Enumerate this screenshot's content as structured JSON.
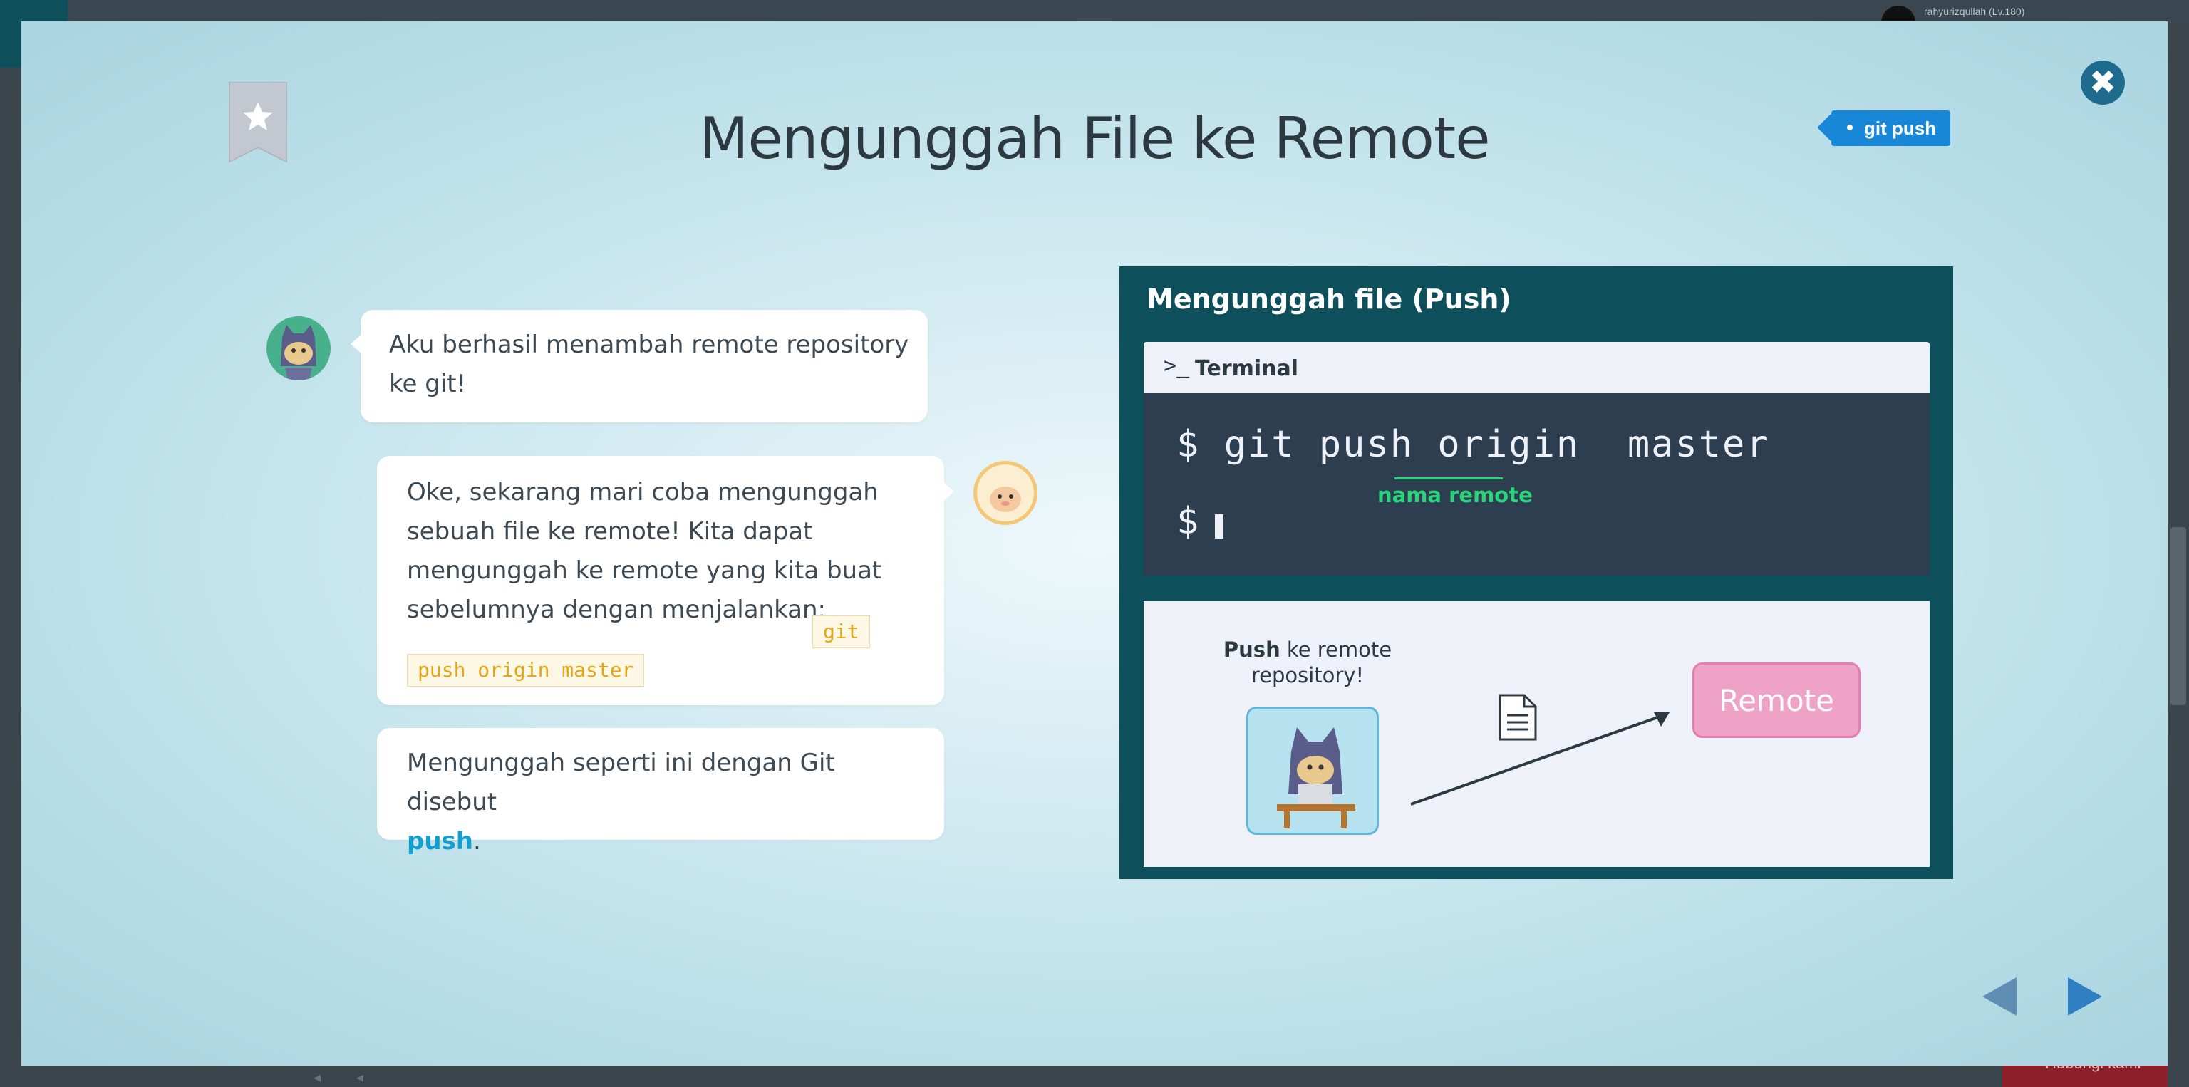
{
  "background": {
    "user_name": "rahyurizqullah (Lv.180)",
    "button_label": "Hubungi kami"
  },
  "modal": {
    "title": "Mengunggah File ke Remote",
    "tag": "git push",
    "close_icon": "close-icon",
    "bookmark_icon": "star-bookmark-icon"
  },
  "chat": {
    "msg1": "Aku berhasil menambah remote repository ke git!",
    "msg2_text": "Oke, sekarang mari coba mengunggah sebuah file ke remote! Kita dapat mengunggah ke remote yang kita buat sebelumnya dengan menjalankan:",
    "msg2_code_part1": "git",
    "msg2_code_part2": "push origin master",
    "msg3_text": "Mengunggah seperti ini dengan Git disebut",
    "msg3_keyword": "push",
    "msg3_end": "."
  },
  "slide": {
    "title": "Mengunggah file (Push)",
    "terminal_label": "Terminal",
    "command_line": "$ git push origin  master",
    "command_hint": "nama remote",
    "prompt": "$",
    "caption_bold": "Push",
    "caption_rest": " ke remote repository!",
    "remote_label": "Remote"
  },
  "colors": {
    "accent": "#1887d8",
    "panel": "#0e4f5c",
    "terminal": "#2c3e4f",
    "hint": "#2bd37a",
    "remote": "#eea3c6",
    "keyword": "#14a0cf"
  }
}
